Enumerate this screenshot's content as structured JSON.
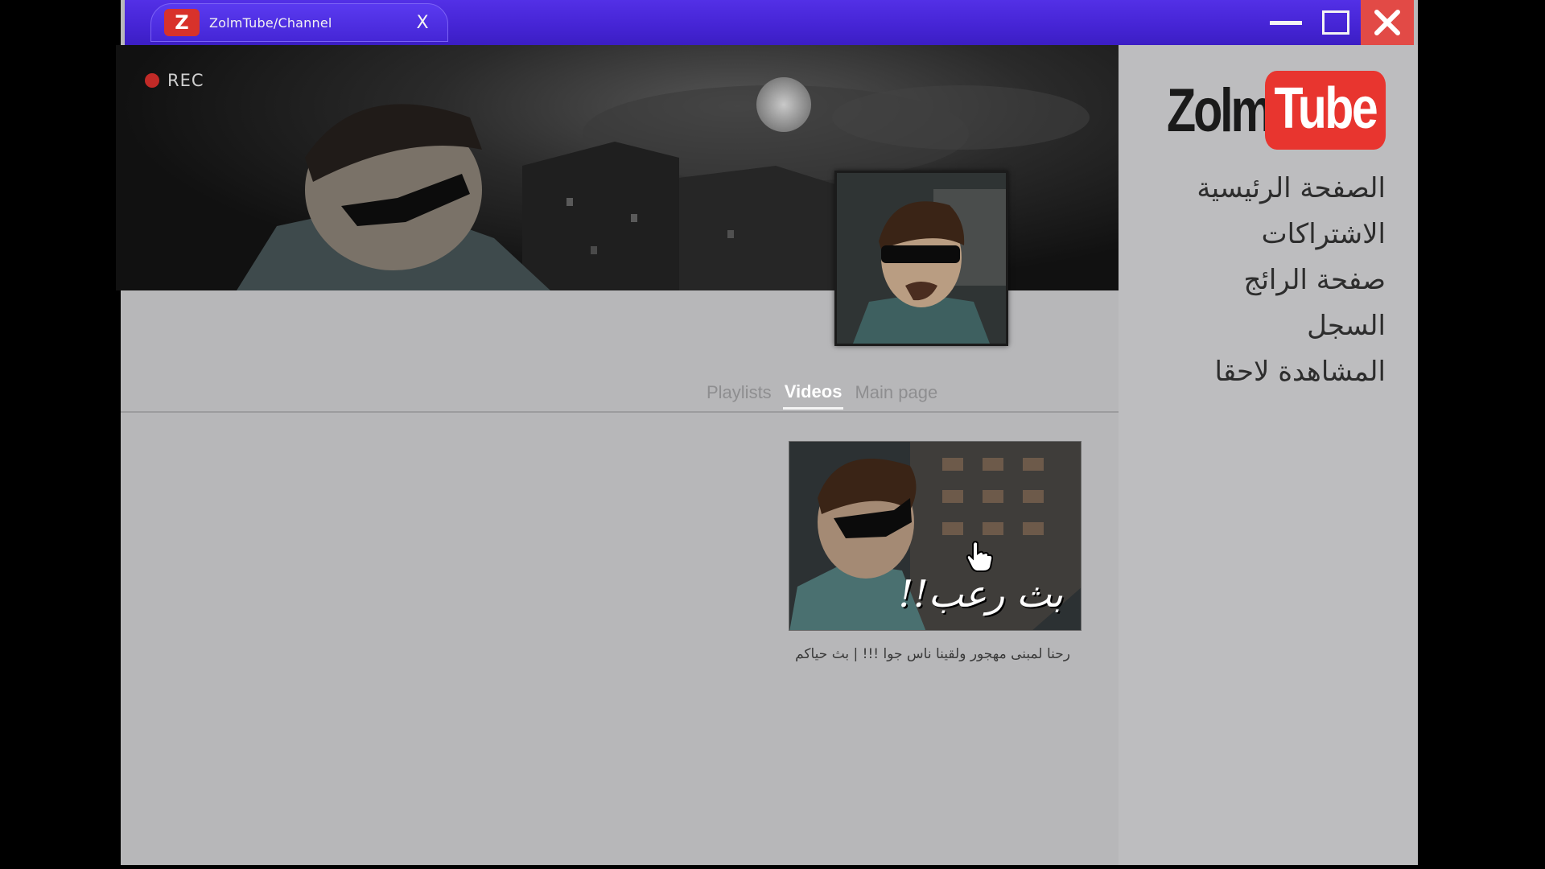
{
  "browser": {
    "tab_title": "ZolmTube/Channel",
    "tab_favicon_letter": "Z",
    "tab_close_symbol": "X"
  },
  "banner": {
    "rec_label": "REC"
  },
  "channel_tabs": [
    {
      "label": "Playlists",
      "active": false
    },
    {
      "label": "Videos",
      "active": true
    },
    {
      "label": "Main page",
      "active": false
    }
  ],
  "video": {
    "thumbnail_caption": "بث رعب!!",
    "title": "رحنا لمبنى مهجور ولقينا ناس جوا !!! | بث حياكم"
  },
  "sidebar": {
    "logo_left": "Zolm",
    "logo_right": "Tube",
    "nav": [
      {
        "label": "الصفحة الرئيسية"
      },
      {
        "label": "الاشتراكات"
      },
      {
        "label": "صفحة الرائج"
      },
      {
        "label": "السجل"
      },
      {
        "label": "المشاهدة لاحقا"
      }
    ]
  },
  "colors": {
    "titlebar": "#4a28dc",
    "close_button": "#e24a46",
    "logo_red": "#e8352f",
    "page_bg": "#b7b7b9"
  }
}
